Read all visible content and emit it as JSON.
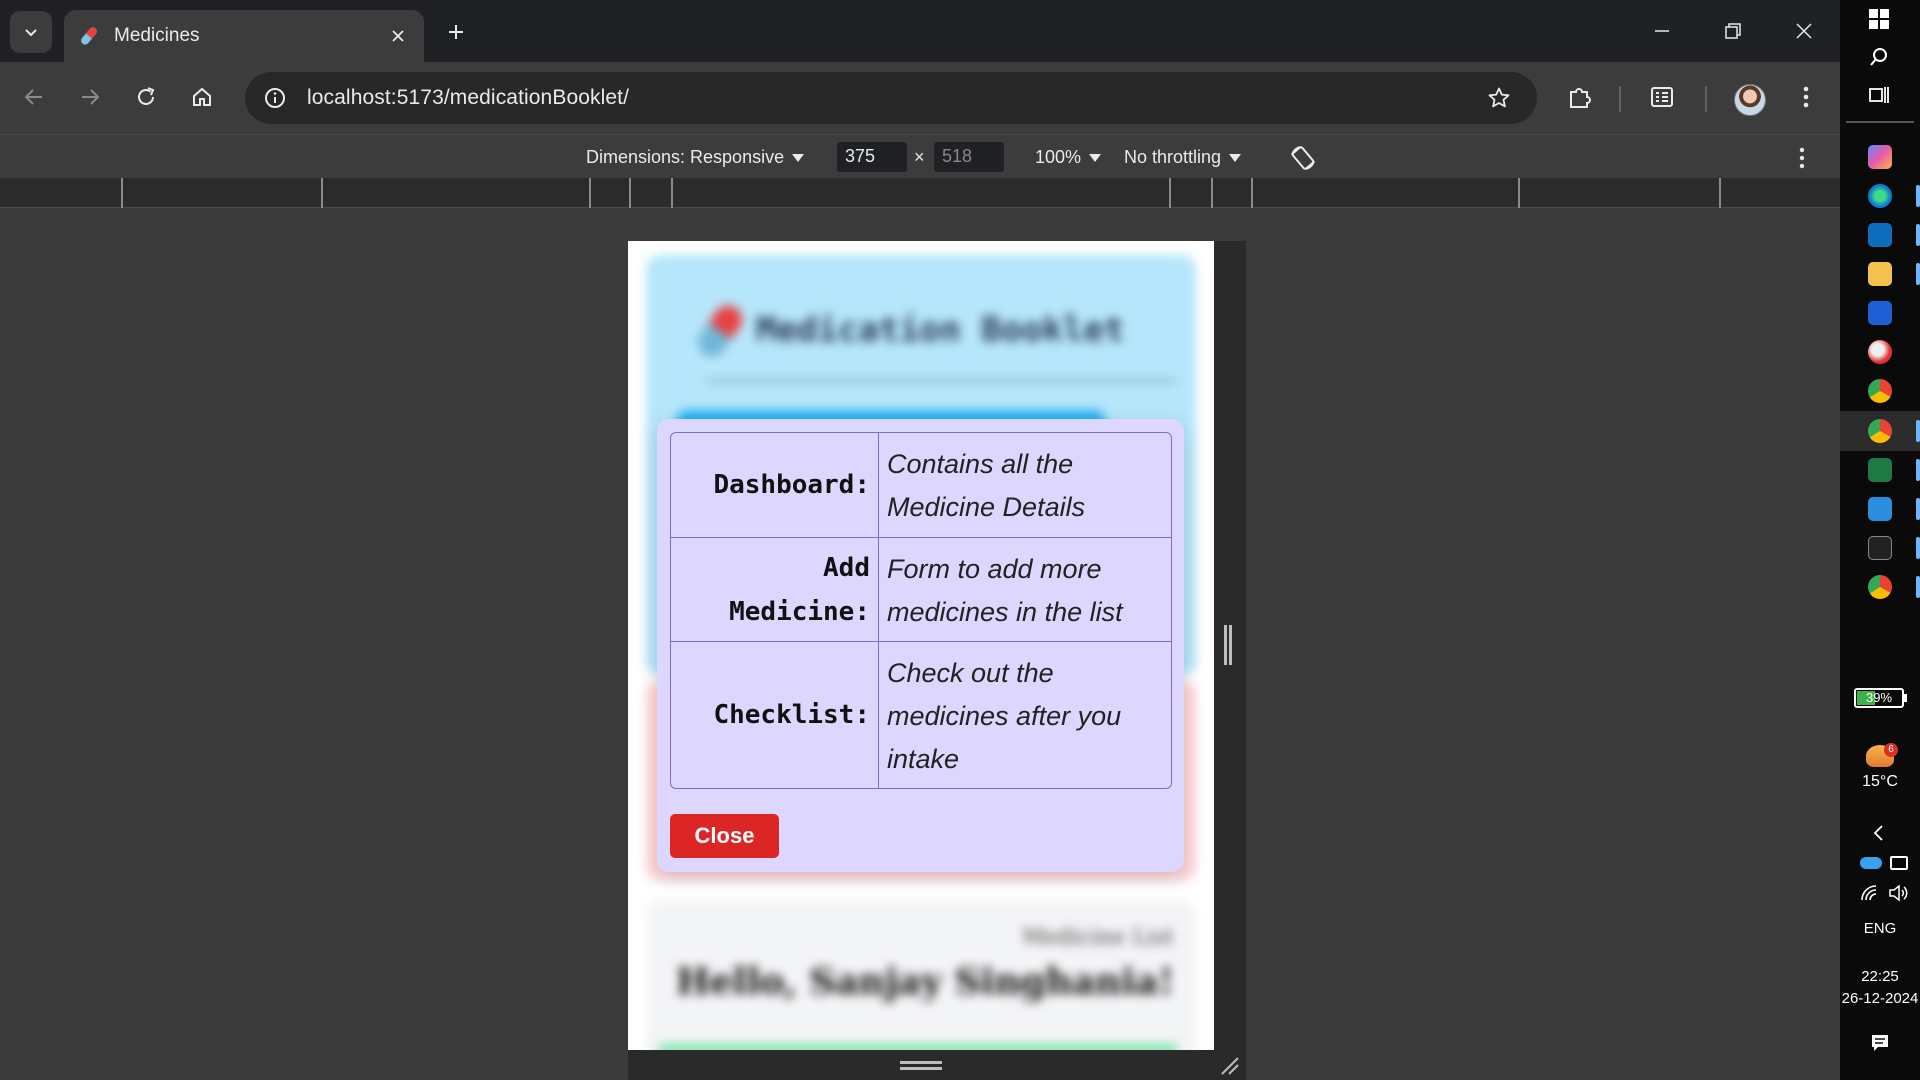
{
  "browser": {
    "tab_title": "Medicines",
    "url_host": "localhost",
    "url_path": ":5173/medicationBooklet/"
  },
  "devtools": {
    "dimensions_label": "Dimensions: Responsive",
    "width": "375",
    "height": "518",
    "times": "×",
    "zoom": "100%",
    "throttling": "No throttling"
  },
  "page": {
    "title": "Medication Booklet",
    "medicine_list_label": "Medicine List",
    "greeting": "Hello, Sanjay Singhania!"
  },
  "modal": {
    "rows": [
      {
        "key": "Dashboard:",
        "value": "Contains all the Medicine Details"
      },
      {
        "key": "Add Medicine:",
        "value": "Form to add more medicines in the list"
      },
      {
        "key": "Checklist:",
        "value": "Check out the medicines after you intake"
      }
    ],
    "close_label": "Close",
    "colors": {
      "background": "#ddd6fe",
      "border": "#7c6fc6",
      "close_button": "#dc2626"
    }
  },
  "taskbar": {
    "battery": "39%",
    "weather_temp": "15°C",
    "weather_badge": "6",
    "language": "ENG",
    "time": "22:25",
    "date": "26-12-2024"
  }
}
